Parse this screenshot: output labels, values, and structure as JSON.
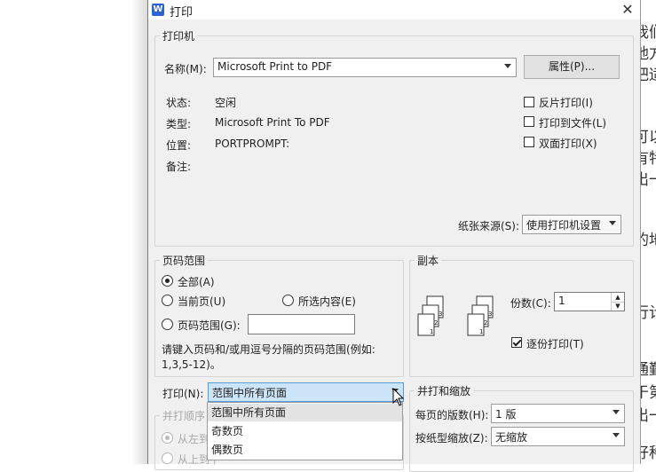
{
  "dialog": {
    "title": "打印",
    "app_icon": "W",
    "close": "✕"
  },
  "printer": {
    "group_label": "打印机",
    "name_label": "名称(M):",
    "name_value": "Microsoft Print to PDF",
    "properties_button": "属性(P)...",
    "status_label": "状态:",
    "status_value": "空闲",
    "type_label": "类型:",
    "type_value": "Microsoft Print To PDF",
    "location_label": "位置:",
    "location_value": "PORTPROMPT:",
    "comment_label": "备注:",
    "reverse_print": "反片打印(I)",
    "print_to_file": "打印到文件(L)",
    "duplex_print": "双面打印(X)",
    "paper_source_label": "纸张来源(S):",
    "paper_source_value": "使用打印机设置"
  },
  "page_range": {
    "group_label": "页码范围",
    "all": "全部(A)",
    "current_page": "当前页(U)",
    "selection": "所选内容(E)",
    "pages": "页码范围(G):",
    "pages_value": "",
    "hint_line1": "请键入页码和/或用逗号分隔的页码范围(例如:",
    "hint_line2": "1,3,5-12)。"
  },
  "copies": {
    "group_label": "副本",
    "count_label": "份数(C):",
    "count_value": "1",
    "collate": "逐份打印(T)",
    "collate_checked": true
  },
  "print_what": {
    "label": "打印(N):",
    "value": "范围中所有页面",
    "options": [
      "范围中所有页面",
      "奇数页",
      "偶数页"
    ]
  },
  "merge": {
    "group_label": "并打顺序",
    "left_to_right": "从左到右",
    "top_to_bottom": "从上到下"
  },
  "zoom": {
    "group_label": "并打和缩放",
    "pages_per_sheet_label": "每页的版数(H):",
    "pages_per_sheet_value": "1 版",
    "scale_label": "按纸型缩放(Z):",
    "scale_value": "无缩放"
  },
  "background_doc": {
    "fragments": [
      "我们",
      "地方",
      "把适",
      "可以",
      "有特",
      "出一。",
      "的地",
      "行计",
      "通勤",
      "于第",
      "出一",
      "好种"
    ]
  },
  "colors": {
    "dialog_bg": "#f0f0f0",
    "selected_combo": "#cce4f7",
    "accent_icon": "#2b62d8"
  }
}
